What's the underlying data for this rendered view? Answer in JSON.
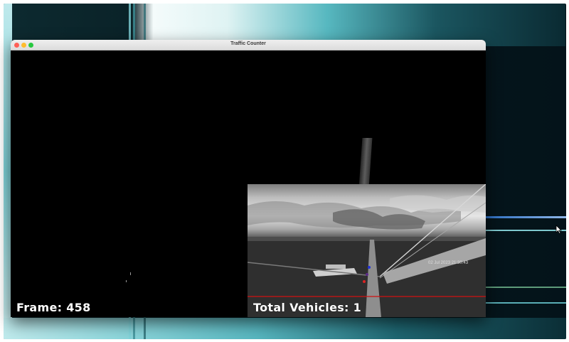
{
  "window": {
    "title": "Traffic Counter"
  },
  "overlay": {
    "frame_label": "Frame:",
    "frame_number": "458",
    "total_label": "Total Vehicles:",
    "total_count": "1",
    "timestamp": "02 Jul 2023  21:30:43"
  },
  "colors": {
    "close": "#ff5f57",
    "minimize": "#febc2e",
    "zoom": "#28c840",
    "count_line": "#d01010",
    "marker_blue": "#2233dd",
    "marker_red": "#dd2222"
  }
}
